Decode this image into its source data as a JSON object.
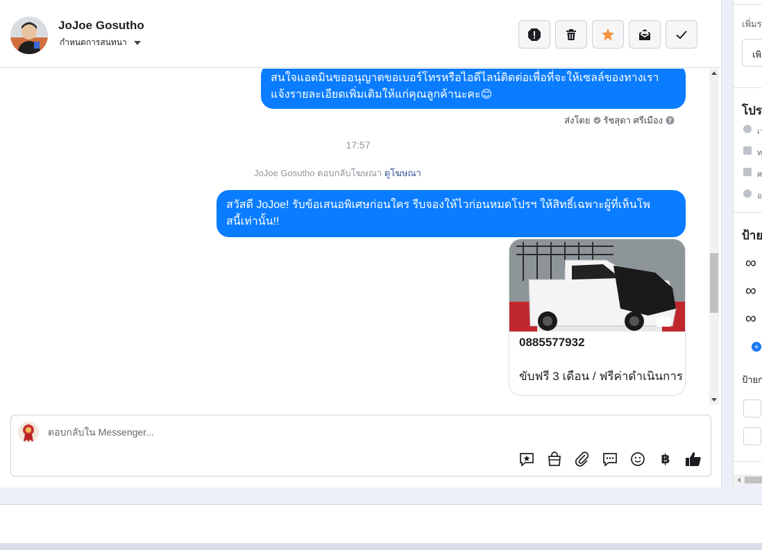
{
  "header": {
    "contact_name": "JoJoe Gosutho",
    "assign_label": "กำหนดการสนทนา",
    "actions": [
      {
        "name": "spam-button",
        "icon": "alert-icon"
      },
      {
        "name": "delete-button",
        "icon": "trash-icon"
      },
      {
        "name": "star-button",
        "icon": "star-icon"
      },
      {
        "name": "mark-unread-button",
        "icon": "envelope-icon"
      },
      {
        "name": "done-button",
        "icon": "check-icon"
      }
    ]
  },
  "messages": {
    "bubble1_line1": "สนใจแอดมินขออนุญาตขอเบอร์โทรหรือไอดีไลน์ติดต่อเพื่อที่จะให้เซลล์ของทางเรา",
    "bubble1_line2": "แจ้งรายละเอียดเพิ่มเติมให้แก่คุณลูกค้านะคะ😊",
    "sent_by_label": "ส่งโดย",
    "sent_by_name": "รัชสุดา ศรีเมือง",
    "timestamp": "17:57",
    "reply_note_text": "JoJoe Gosutho ตอบกลับโฆษณา",
    "reply_note_link": "ดูโฆษณา",
    "bubble2_line1": "สวัสดี JoJoe! รับข้อเสนอพิเศษก่อนใคร รีบจองให้ไวก่อนหมดโปรฯ ให้สิทธิ์เฉพาะผู้ที่เห็นโพ",
    "bubble2_line2": "สนี้เท่านั้น!!",
    "card_title": "0885577932",
    "card_subtitle": "ขับฟรี 3 เดือน / ฟรีค่าดำเนินการ"
  },
  "composer": {
    "placeholder": "ตอบกลับใน Messenger...",
    "tools": [
      "saved-reply-icon",
      "shop-bag-icon",
      "attach-icon",
      "chat-bubble-icon",
      "emoji-icon",
      "baht-icon",
      "thumbs-up-icon"
    ],
    "baht_symbol": "฿"
  },
  "right_panel": {
    "text_top": "เพิ่มร",
    "button_partial": "เพิ",
    "section_profile": "โปร",
    "profile_rows": [
      "เว",
      "ท",
      "ศ",
      "อ"
    ],
    "section_labels": "ป้าย",
    "labels_sub": "ป้ายก",
    "meta_symbol": "∞"
  }
}
